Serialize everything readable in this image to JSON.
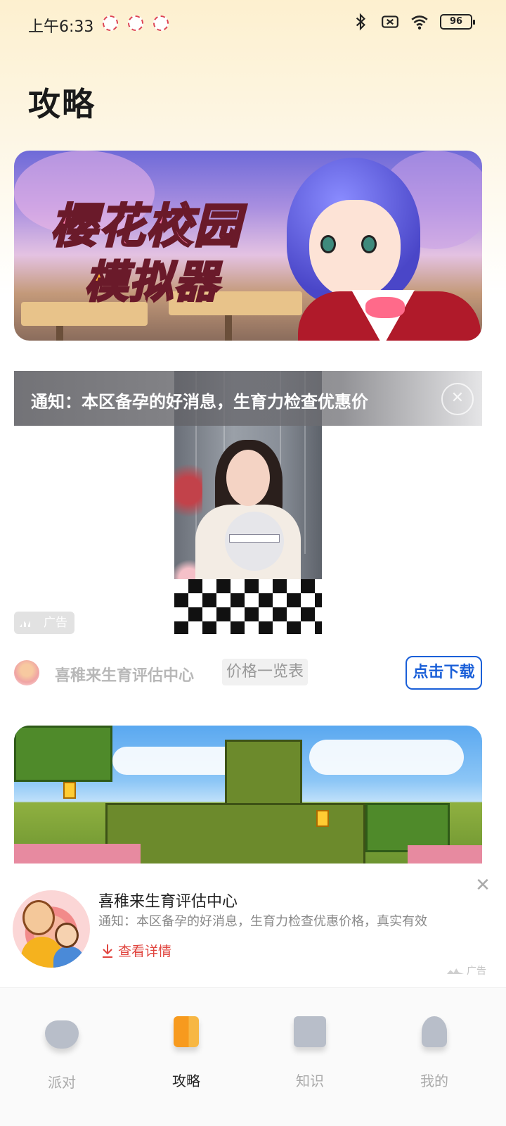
{
  "status_bar": {
    "time": "上午6:33",
    "battery": "96"
  },
  "page": {
    "title": "攻略"
  },
  "banner": {
    "title_line1": "樱花校园",
    "title_line2": "模拟器"
  },
  "ad_card": {
    "notice": "通知：本区备孕的好消息，生育力检查优惠价",
    "close_symbol": "✕",
    "ad_tag": "广告",
    "advertiser": "喜稚来生育评估中心",
    "price_tag": "价格一览表",
    "download_button": "点击下载"
  },
  "float_ad": {
    "title": "喜稚来生育评估中心",
    "description": "通知：本区备孕的好消息，生育力检查优惠价格，真实有效",
    "detail_link": "查看详情",
    "close_symbol": "✕",
    "ad_tag": "广告"
  },
  "bottom_nav": {
    "items": [
      {
        "label": "派对",
        "icon": "party-icon",
        "active": false
      },
      {
        "label": "攻略",
        "icon": "guide-icon",
        "active": true
      },
      {
        "label": "知识",
        "icon": "knowledge-icon",
        "active": false
      },
      {
        "label": "我的",
        "icon": "profile-icon",
        "active": false
      }
    ]
  },
  "colors": {
    "accent_blue": "#1a5fd8",
    "accent_red": "#e0443e",
    "active_nav_icon": "#f79a1e",
    "header_gradient_top": "#fdf0cf"
  }
}
